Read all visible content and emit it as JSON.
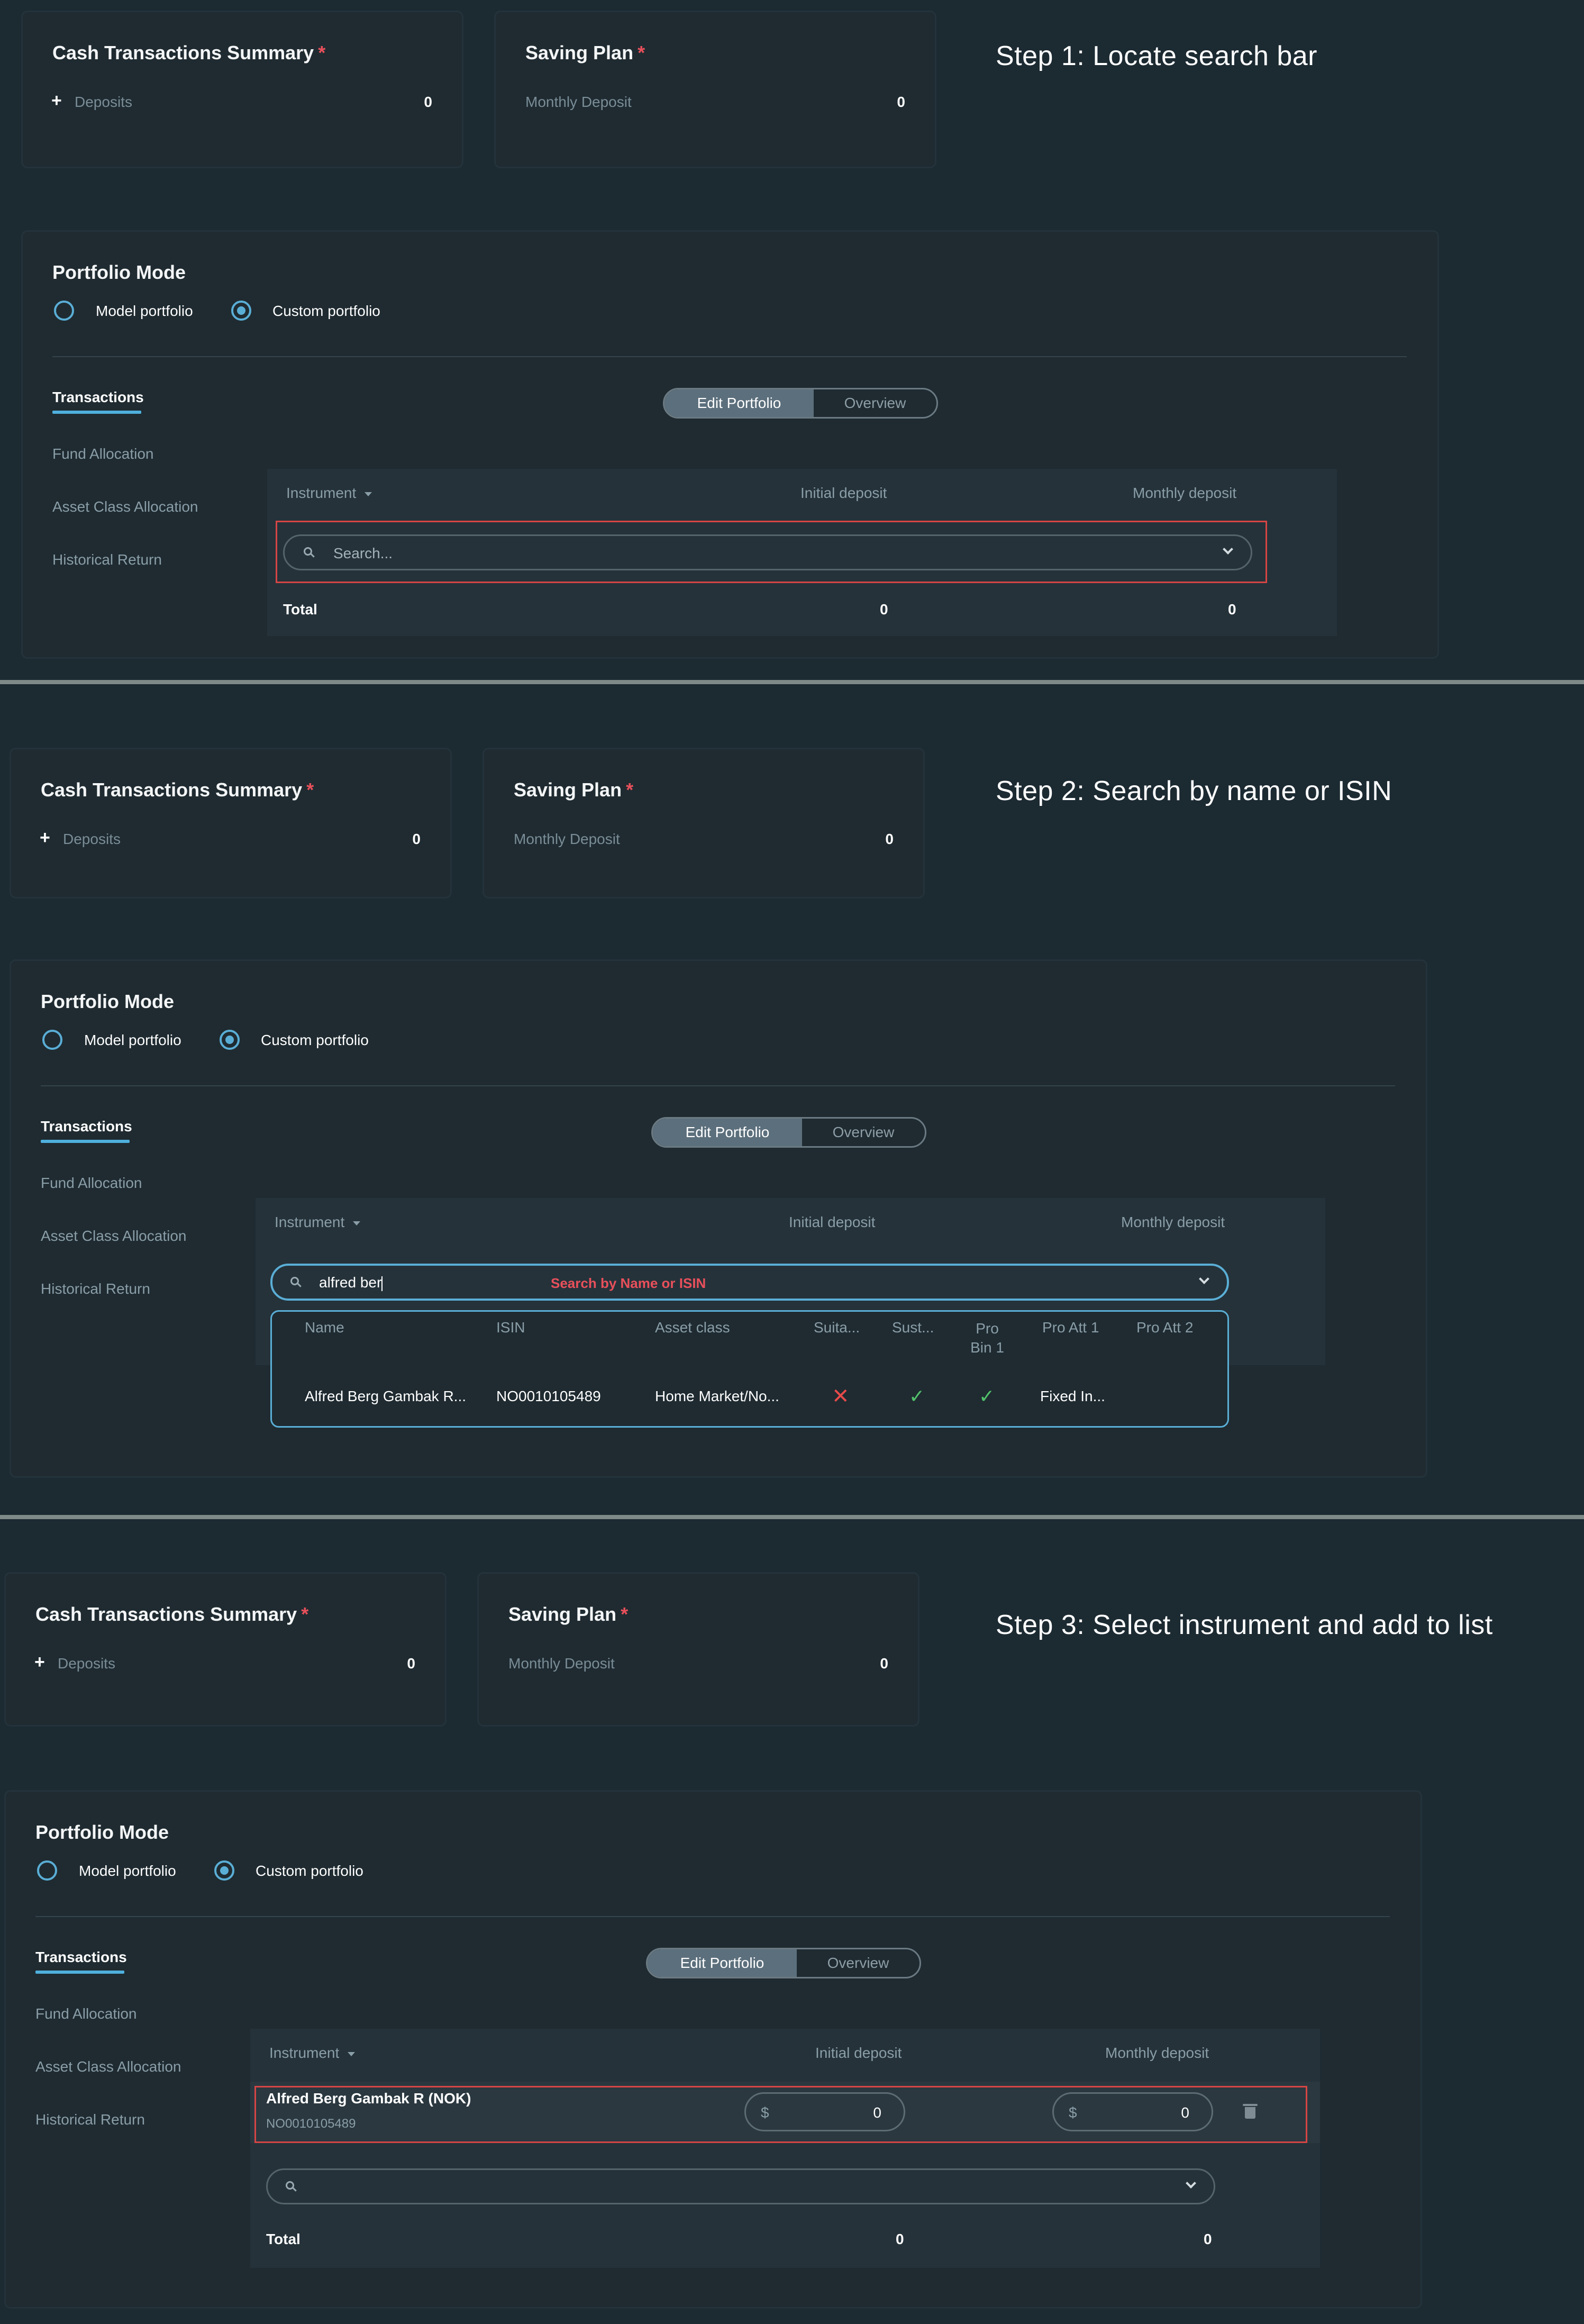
{
  "summary": {
    "title": "Cash Transactions Summary",
    "required_mark": "*",
    "deposits_label": "Deposits",
    "deposits_value": "0",
    "plus": "+"
  },
  "saving_plan": {
    "title": "Saving Plan",
    "required_mark": "*",
    "monthly_label": "Monthly Deposit",
    "monthly_value": "0"
  },
  "steps": {
    "step1": "Step 1: Locate search bar",
    "step2": "Step 2: Search by name or ISIN",
    "step3": "Step 3: Select instrument and add to list"
  },
  "portfolio_mode": {
    "title": "Portfolio Mode",
    "model_label": "Model portfolio",
    "custom_label": "Custom portfolio",
    "selected": "custom"
  },
  "nav": {
    "transactions": "Transactions",
    "fund_allocation": "Fund Allocation",
    "asset_class_allocation": "Asset Class Allocation",
    "historical_return": "Historical Return"
  },
  "toggle": {
    "edit": "Edit Portfolio",
    "overview": "Overview"
  },
  "table": {
    "instrument": "Instrument",
    "initial": "Initial deposit",
    "monthly": "Monthly deposit",
    "total_label": "Total",
    "total_initial": "0",
    "total_monthly": "0"
  },
  "search": {
    "placeholder": "Search...",
    "typed": "alfred ber",
    "hint": "Search by Name or ISIN"
  },
  "results": {
    "headers": {
      "name": "Name",
      "isin": "ISIN",
      "asset_class": "Asset class",
      "suitability": "Suita...",
      "sustainability": "Sust...",
      "pro_bin": "Pro Bin 1",
      "pro_att1": "Pro Att 1",
      "pro_att2": "Pro Att 2"
    },
    "row": {
      "name": "Alfred Berg Gambak R...",
      "isin": "NO0010105489",
      "asset_class": "Home Market/No...",
      "pro_att1": "Fixed In..."
    }
  },
  "instrument_row": {
    "name": "Alfred Berg Gambak R (NOK)",
    "isin": "NO0010105489",
    "currency": "$",
    "initial": "0",
    "monthly": "0"
  },
  "colors": {
    "background": "#1c2a32",
    "accent": "#5aaed6",
    "required": "#e8505b",
    "highlight": "#d64545",
    "check": "#53c26b",
    "cross": "#e84a4a"
  }
}
